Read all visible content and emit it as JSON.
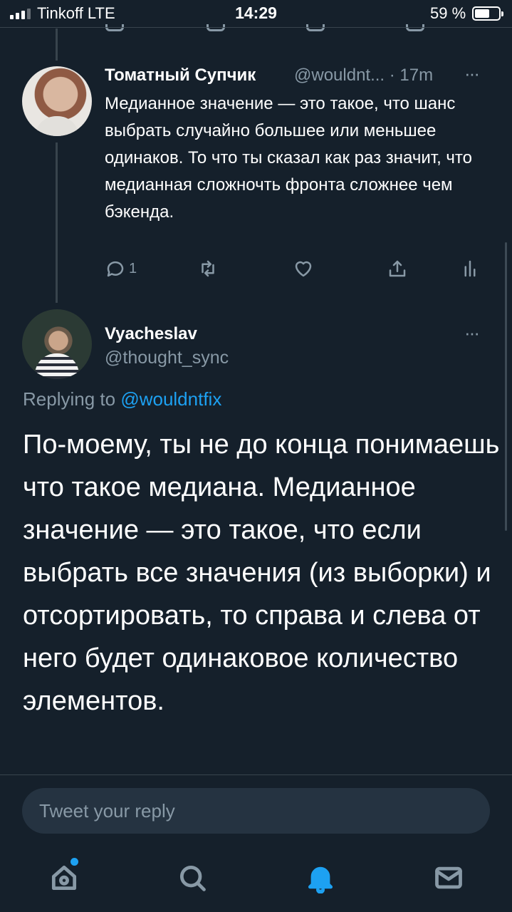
{
  "status_bar": {
    "carrier": "Tinkoff  LTE",
    "time": "14:29",
    "battery_percent": "59 %",
    "battery_level": 0.59
  },
  "parent_tweet": {
    "author_name": "Томатный Супчик",
    "author_handle": "@wouldnt... · 17m",
    "more": "···",
    "text": "Медианное значение — это такое, что шанс выбрать случайно большее или меньшее одинаков. То что ты сказал как раз значит, что медианная сложночть фронта сложнее чем бэкенда.",
    "reply_count": "1",
    "icons": [
      "reply-icon",
      "retweet-icon",
      "like-icon",
      "share-icon",
      "analytics-icon"
    ]
  },
  "focused_tweet": {
    "author_name": "Vyacheslav",
    "author_handle": "@thought_sync",
    "more": "···",
    "replying_prefix": "Replying to ",
    "replying_to": "@wouldntfix",
    "text": "По-моему, ты не до конца понимаешь что такое медиана. Медианное значение — это такое, что если выбрать все значения (из выборки) и отсортировать, то справа и слева от него будет одинаковое количество элементов."
  },
  "reply_composer": {
    "placeholder": "Tweet your reply"
  },
  "tab_bar": {
    "tabs": [
      "home-icon",
      "search-icon",
      "notifications-icon",
      "messages-icon"
    ],
    "active": "notifications-icon",
    "accent_color": "#1da1f2"
  },
  "theme": {
    "background": "#15202b",
    "secondary_text": "#8899a6",
    "accent": "#1da1f2"
  }
}
